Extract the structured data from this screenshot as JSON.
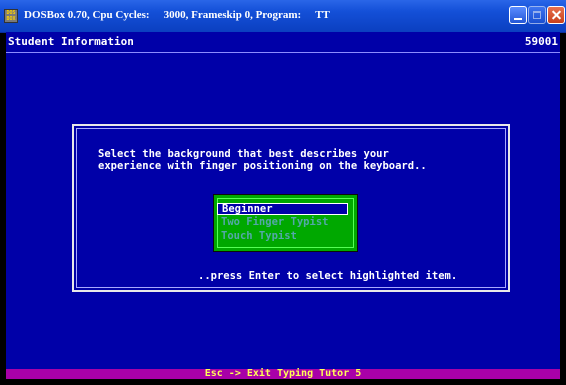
{
  "window": {
    "app_icon_text": "DOS BOX",
    "title_app": "DOSBox 0.70, Cpu Cycles:",
    "title_cycles": "3000, Frameskip  0, Program:",
    "title_program": "TT"
  },
  "screen": {
    "title": "Student Information",
    "code": "59001"
  },
  "dialog": {
    "prompt_line1": "Select the background that best describes your",
    "prompt_line2": "experience with finger positioning on the keyboard..",
    "options": [
      "Beginner",
      "Two Finger Typist",
      "Touch Typist"
    ],
    "selected_index": 0,
    "hint": "..press Enter to select highlighted item."
  },
  "status_bar": {
    "text": "Esc -> Exit Typing Tutor 5"
  },
  "colors": {
    "screen_bg": "#0000a8",
    "menu_bg": "#00a800",
    "status_bg": "#a800a8",
    "status_fg": "#ffff55"
  }
}
